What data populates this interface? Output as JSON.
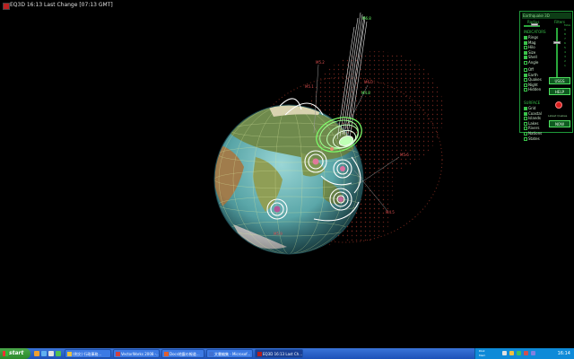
{
  "window": {
    "title": "EQ3D  16:13 Last Change  [07:13 GMT]",
    "icon": "earthquake-app-icon"
  },
  "panel": {
    "title": "Earthquake 3D",
    "groups": {
      "radius": "Radius",
      "filters": "Filters",
      "indicators": "INDICATORS",
      "surface": "SURFACE"
    },
    "mag_scale": [
      "MAG",
      "9",
      "8",
      "7",
      "6",
      "5",
      "4",
      "3",
      "2",
      "1"
    ],
    "radius_level": 0.55,
    "mag_filter_level": 0.25,
    "indicators": [
      {
        "label": "Rings",
        "checked": true
      },
      {
        "label": "Mag",
        "checked": true
      },
      {
        "label": "Hilo",
        "checked": false
      },
      {
        "label": "Size",
        "checked": true
      },
      {
        "label": "Shell",
        "checked": true
      },
      {
        "label": "Angle",
        "checked": false
      }
    ],
    "view": [
      {
        "label": "Off",
        "checked": false
      },
      {
        "label": "Earth",
        "checked": true
      },
      {
        "label": "Quakes",
        "checked": false
      },
      {
        "label": "Night",
        "checked": false
      },
      {
        "label": "Hidden",
        "checked": false
      }
    ],
    "surface": [
      {
        "label": "Grid",
        "checked": true
      },
      {
        "label": "Coastal",
        "checked": true
      },
      {
        "label": "Islands",
        "checked": false
      },
      {
        "label": "Lakes",
        "checked": false
      },
      {
        "label": "Rivers",
        "checked": false
      },
      {
        "label": "Nations",
        "checked": false
      },
      {
        "label": "States",
        "checked": false
      }
    ],
    "buttons": {
      "usgs": "USGS",
      "help": "HELP",
      "now": "NOW"
    },
    "latest_label": "Latest Quakes",
    "record_icon": "record-icon"
  },
  "quake_labels": [
    "M5.2",
    "M6.0",
    "M4.8",
    "M5.6",
    "M4.5",
    "M5.9",
    "M6.8",
    "M5.1"
  ],
  "taskbar": {
    "start": "start",
    "tasks": [
      {
        "label": "(例文) 行政事務...",
        "active": false
      },
      {
        "label": "VectorWorks 2008 -...",
        "active": false
      },
      {
        "label": "Docs地震の報道...",
        "active": false
      },
      {
        "label": "文書編集 - Microsof...",
        "active": false
      },
      {
        "label": "EQ3D  16:13 Last Ch...",
        "active": true
      }
    ],
    "tray_lines": [
      "Disk",
      "Mem"
    ],
    "clock": "16:14"
  },
  "colors": {
    "panel_green": "#39c24a",
    "quake_green": "#7dff6a",
    "quake_white": "#ffffff",
    "quake_red": "#c0392b",
    "taskbar_blue": "#2458c8"
  }
}
